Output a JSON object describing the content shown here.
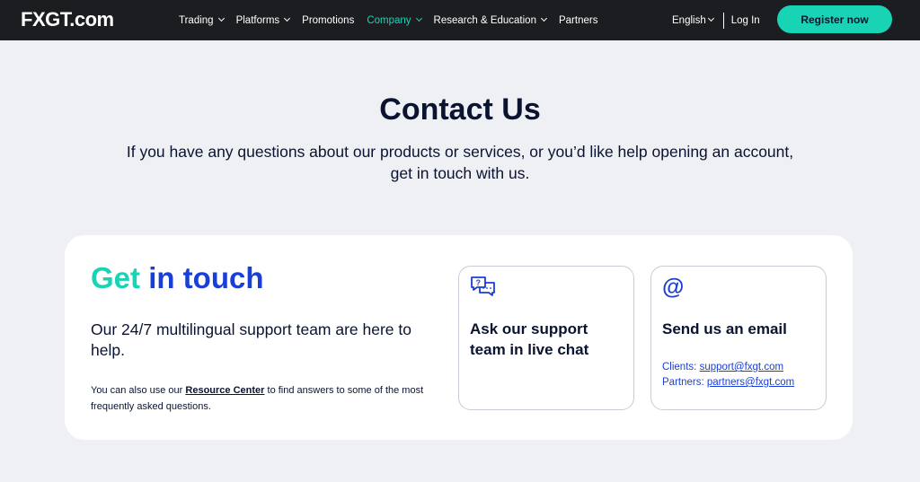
{
  "header": {
    "logo_main": "FXGT",
    "logo_suffix": ".com",
    "nav": [
      {
        "label": "Trading",
        "dropdown": true
      },
      {
        "label": "Platforms",
        "dropdown": true
      },
      {
        "label": "Promotions",
        "dropdown": false
      },
      {
        "label": "Company",
        "dropdown": true,
        "active": true
      },
      {
        "label": "Research & Education",
        "dropdown": true
      },
      {
        "label": "Partners",
        "dropdown": false
      }
    ],
    "language": "English",
    "login": "Log In",
    "register": "Register now"
  },
  "hero": {
    "title": "Contact Us",
    "subtitle_line1": "If you have any questions about our products or services, or you’d like help opening an account,",
    "subtitle_line2": "get in touch with us."
  },
  "card": {
    "heading_part1": "Get",
    "heading_part2": "in touch",
    "support_text": "Our 24/7 multilingual support team are here to help.",
    "resource_prefix": "You can also use our ",
    "resource_link": "Resource Center",
    "resource_suffix": " to find answers to some of the most frequently asked questions.",
    "live_chat": {
      "icon": "chat-bubbles-question-icon",
      "title": "Ask our support team in live chat"
    },
    "email": {
      "icon": "at-sign-icon",
      "title": "Send us an email",
      "clients_label": "Clients:",
      "clients_email": "support@fxgt.com",
      "partners_label": "Partners:",
      "partners_email": "partners@fxgt.com"
    }
  },
  "colors": {
    "nav_bg": "#1c1d21",
    "accent_teal": "#19d3b5",
    "accent_blue": "#1a3fd6",
    "page_bg": "#eff0f4",
    "text_dark": "#0a1330"
  }
}
